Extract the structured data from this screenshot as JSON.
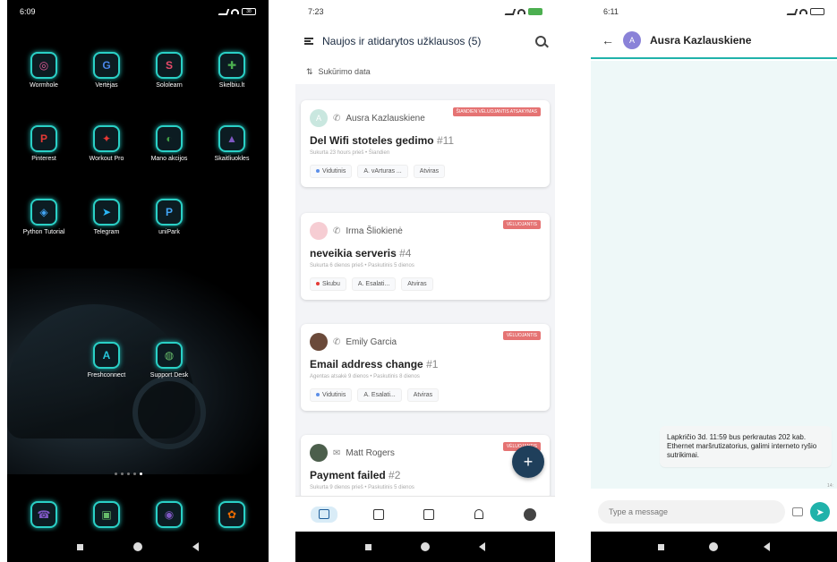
{
  "home": {
    "time": "6:09",
    "battery": "38",
    "apps": [
      {
        "label": "Wormhole",
        "glyph": "◎",
        "color": "#e95a9a"
      },
      {
        "label": "Vertėjas",
        "glyph": "G",
        "color": "#4a86e8"
      },
      {
        "label": "Sololearn",
        "glyph": "S",
        "color": "#e84a6a"
      },
      {
        "label": "Skelbiu.lt",
        "glyph": "✚",
        "color": "#4caf50"
      },
      {
        "label": "Pinterest",
        "glyph": "P",
        "color": "#e53935"
      },
      {
        "label": "Workout Pro",
        "glyph": "✦",
        "color": "#e53935"
      },
      {
        "label": "Mano akcijos",
        "glyph": "◐",
        "color": "#43a047"
      },
      {
        "label": "Skaitliuokles",
        "glyph": "▲",
        "color": "#7e57c2"
      },
      {
        "label": "Python Tutorial",
        "glyph": "◈",
        "color": "#42a5f5"
      },
      {
        "label": "Telegram",
        "glyph": "➤",
        "color": "#29b6f6"
      },
      {
        "label": "uniPark",
        "glyph": "P",
        "color": "#42a5f5"
      }
    ],
    "apps2": [
      {
        "label": "Freshconnect",
        "glyph": "A",
        "color": "#26c6da"
      },
      {
        "label": "Support Desk",
        "glyph": "◍",
        "color": "#66bb6a"
      }
    ],
    "dock": [
      {
        "label": "",
        "glyph": "☎",
        "color": "#7e57c2"
      },
      {
        "label": "",
        "glyph": "▣",
        "color": "#66bb6a"
      },
      {
        "label": "",
        "glyph": "◉",
        "color": "#7e57c2"
      },
      {
        "label": "",
        "glyph": "✿",
        "color": "#ef6c00"
      }
    ]
  },
  "tickets": {
    "time": "7:23",
    "title": "Naujos ir atidarytos užklausos (5)",
    "sort_label": "Sukūrimo data",
    "cards": [
      {
        "name": "Ausra Kazlauskiene",
        "avatar": "A",
        "title": "Del Wifi stoteles gedimo",
        "num": "#11",
        "badge": "ŠIANDIEN VĖLUOJANTIS ATSAKYMAS",
        "meta": "Sukurta 23 hours prieš • Šiandien",
        "chips": [
          "Vidutinis",
          "A. vArturas ...",
          "Atviras"
        ],
        "dot": "#5c8fe8"
      },
      {
        "name": "Irma Šliokienė",
        "avatar": "",
        "title": "neveikia serveris",
        "num": "#4",
        "badge": "VĖLUOJANTIS",
        "meta": "Sukurta 6 dienos prieš • Paskutinis 5 dienos",
        "chips": [
          "Skubu",
          "A. Esalati...",
          "Atviras"
        ],
        "dot": "#e53935"
      },
      {
        "name": "Emily Garcia",
        "avatar": "",
        "title": "Email address change",
        "num": "#1",
        "badge": "VĖLUOJANTIS",
        "meta": "Agentas atsakė 9 dienos • Paskutinis 8 dienos",
        "chips": [
          "Vidutinis",
          "A. Esalati...",
          "Atviras"
        ],
        "dot": "#5c8fe8"
      },
      {
        "name": "Matt Rogers",
        "avatar": "",
        "title": "Payment failed",
        "num": "#2",
        "badge": "VĖLUOJANTIS",
        "meta": "Sukurta 9 dienos prieš • Paskutinis 5 dienos",
        "chips": [],
        "dot": "#5c8fe8"
      }
    ],
    "fab": "+"
  },
  "chat": {
    "time": "6:11",
    "contact": "Ausra Kazlauskiene",
    "avatar": "A",
    "message": "Lapkričio 3d. 11:59 bus perkrautas 202 kab. Ethernet maršrutizatorius, galimi interneto ryšio sutrikimai.",
    "message_time": "14:",
    "input_placeholder": "Type a message"
  }
}
